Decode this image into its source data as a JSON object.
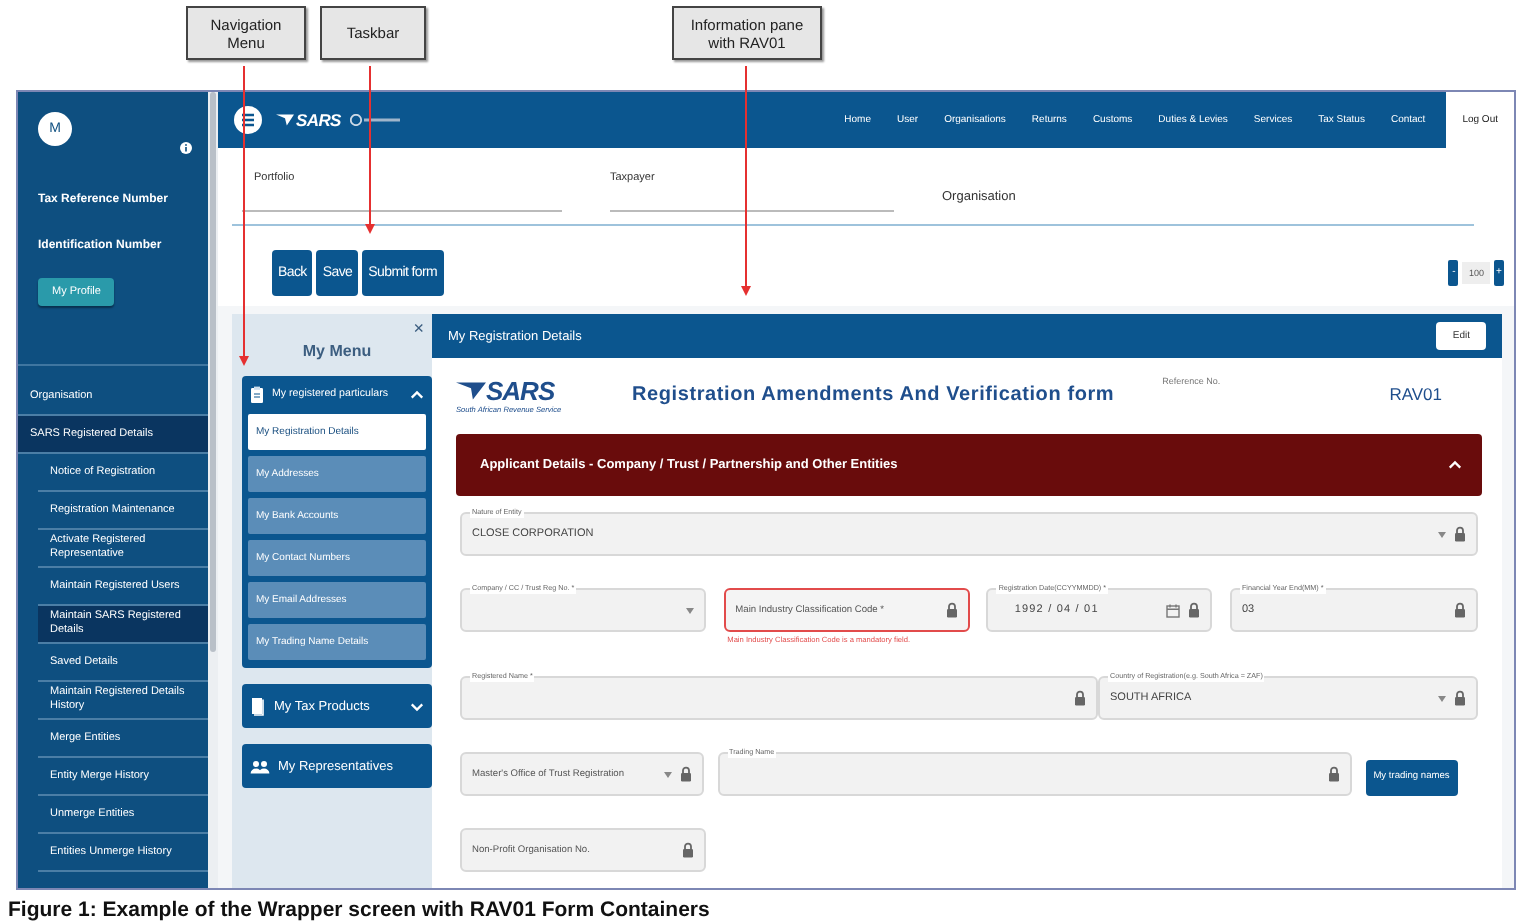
{
  "callouts": [
    "Navigation Menu",
    "Taskbar",
    "Information pane with RAV01"
  ],
  "sidebar": {
    "avatar": "M",
    "labels": [
      "Tax Reference Number",
      "Identification Number"
    ],
    "profile_button": "My Profile",
    "items": [
      {
        "label": "Organisation",
        "selected": false
      },
      {
        "label": "SARS Registered Details",
        "selected": true,
        "children": [
          {
            "label": "Notice of Registration",
            "selected": false
          },
          {
            "label": "Registration Maintenance",
            "selected": false
          },
          {
            "label": "Activate Registered Representative",
            "selected": false
          },
          {
            "label": "Maintain Registered Users",
            "selected": false
          },
          {
            "label": "Maintain SARS Registered Details",
            "selected": true
          },
          {
            "label": "Saved Details",
            "selected": false
          },
          {
            "label": "Maintain Registered Details History",
            "selected": false
          },
          {
            "label": "Merge Entities",
            "selected": false
          },
          {
            "label": "Entity Merge History",
            "selected": false
          },
          {
            "label": "Unmerge Entities",
            "selected": false
          },
          {
            "label": "Entities Unmerge History",
            "selected": false
          }
        ]
      }
    ]
  },
  "topbar": {
    "logo": "SARS",
    "nav": [
      {
        "label": "Home",
        "kind": "link"
      },
      {
        "label": "User",
        "kind": "link"
      },
      {
        "label": "Organisations",
        "kind": "link"
      },
      {
        "label": "Returns",
        "kind": "link"
      },
      {
        "label": "Customs",
        "kind": "link"
      },
      {
        "label": "Duties & Levies",
        "kind": "link"
      },
      {
        "label": "Services",
        "kind": "link"
      },
      {
        "label": "Tax Status",
        "kind": "link"
      },
      {
        "label": "Contact",
        "kind": "link"
      },
      {
        "label": "Log Out",
        "kind": "button"
      }
    ]
  },
  "filters": {
    "portfolio": "Portfolio",
    "taxpayer": "Taxpayer",
    "organisation": "Organisation"
  },
  "toolbar": {
    "buttons": [
      "Back",
      "Save",
      "Submit form"
    ],
    "zoom": {
      "minus": "-",
      "value": "100",
      "plus": "+"
    }
  },
  "my_menu": {
    "title": "My Menu",
    "close": "×",
    "groups": [
      {
        "label": "My registered particulars",
        "kind": "group",
        "expanded": true,
        "children": [
          {
            "label": "My Registration Details",
            "selected": true
          },
          {
            "label": "My Addresses",
            "selected": false
          },
          {
            "label": "My Bank Accounts",
            "selected": false
          },
          {
            "label": "My Contact Numbers",
            "selected": false
          },
          {
            "label": "My Email Addresses",
            "selected": false
          },
          {
            "label": "My Trading Name Details",
            "selected": false
          }
        ]
      },
      {
        "label": "My Tax Products",
        "kind": "group",
        "expanded": false
      },
      {
        "label": "My Representatives",
        "kind": "link"
      }
    ]
  },
  "pane": {
    "title": "My Registration Details",
    "edit_button": "Edit",
    "logo": "SARS",
    "logo_caption": "South African Revenue Service",
    "form_title": "Registration Amendments And Verification form",
    "reference_label": "Reference No.",
    "reference": "RAV01",
    "section": {
      "title": "Applicant Details - Company / Trust / Partnership and Other Entities",
      "expanded": true
    },
    "rows": [
      [
        {
          "kind": "select",
          "label": "Nature of Entity",
          "value": "CLOSE CORPORATION",
          "locked": true
        }
      ],
      [
        {
          "kind": "select",
          "label": "Company / CC / Trust Reg No. *",
          "locked": false
        },
        {
          "kind": "text",
          "placeholder": "Main Industry Classification Code *",
          "locked": true,
          "error": "Main Industry Classification Code is a mandatory field."
        },
        {
          "kind": "date",
          "label": "Registration Date(CCYYMMDD) *",
          "value": "1992 / 04 / 01",
          "locked": true
        },
        {
          "kind": "text",
          "label": "Financial Year End(MM) *",
          "value": "03",
          "locked": true
        }
      ],
      [
        {
          "kind": "text",
          "label": "Registered Name *",
          "locked": true
        },
        {
          "kind": "select",
          "label": "Country of Registration(e.g. South Africa = ZAF)",
          "value": "SOUTH AFRICA",
          "locked": true
        }
      ],
      [
        {
          "kind": "select",
          "placeholder": "Master's Office of Trust Registration",
          "locked": true
        },
        {
          "kind": "text",
          "label": "Trading Name",
          "locked": true
        },
        {
          "kind": "button",
          "text": "My trading names"
        }
      ],
      [
        {
          "kind": "text",
          "placeholder": "Non-Profit Organisation No.",
          "locked": true
        }
      ]
    ]
  },
  "caption": "Figure 1: Example of the Wrapper screen with RAV01 Form Containers"
}
